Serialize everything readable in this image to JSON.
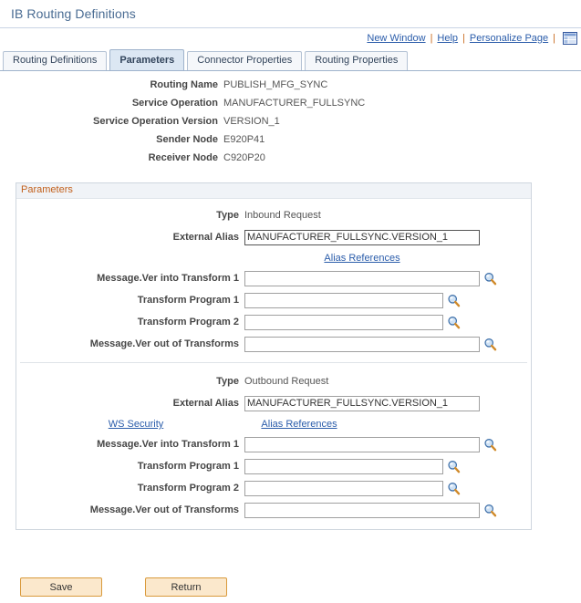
{
  "header": {
    "title": "IB Routing Definitions"
  },
  "utility_links": {
    "new_window": "New Window",
    "help": "Help",
    "personalize_page": "Personalize Page",
    "separator": "|",
    "grid_icon": "page-grid-icon"
  },
  "tabs": [
    {
      "label": "Routing Definitions",
      "active": false
    },
    {
      "label": "Parameters",
      "active": true
    },
    {
      "label": "Connector Properties",
      "active": false
    },
    {
      "label": "Routing Properties",
      "active": false
    }
  ],
  "routing_info": [
    {
      "label": "Routing Name",
      "value": "PUBLISH_MFG_SYNC"
    },
    {
      "label": "Service Operation",
      "value": "MANUFACTURER_FULLSYNC"
    },
    {
      "label": "Service Operation Version",
      "value": "VERSION_1"
    },
    {
      "label": "Sender Node",
      "value": "E920P41"
    },
    {
      "label": "Receiver Node",
      "value": "C920P20"
    }
  ],
  "parameters_group": {
    "title": "Parameters",
    "inbound": {
      "type_label": "Type",
      "type_value": "Inbound Request",
      "external_alias_label": "External Alias",
      "external_alias_value": "MANUFACTURER_FULLSYNC.VERSION_1",
      "alias_references_link": "Alias References",
      "msg_in_label": "Message.Ver into Transform 1",
      "msg_in_value": "",
      "transform1_label": "Transform Program 1",
      "transform1_value": "",
      "transform2_label": "Transform Program 2",
      "transform2_value": "",
      "msg_out_label": "Message.Ver out of Transforms",
      "msg_out_value": "",
      "lookup_icon": "magnifier-lookup-icon"
    },
    "outbound": {
      "type_label": "Type",
      "type_value": "Outbound Request",
      "external_alias_label": "External Alias",
      "external_alias_value": "MANUFACTURER_FULLSYNC.VERSION_1",
      "ws_security_link": "WS Security",
      "alias_references_link": "Alias References",
      "msg_in_label": "Message.Ver into Transform 1",
      "msg_in_value": "",
      "transform1_label": "Transform Program 1",
      "transform1_value": "",
      "transform2_label": "Transform Program 2",
      "transform2_value": "",
      "msg_out_label": "Message.Ver out of Transforms",
      "msg_out_value": "",
      "lookup_icon": "magnifier-lookup-icon"
    }
  },
  "footer_buttons": {
    "save": "Save",
    "return": "Return"
  },
  "colors": {
    "title_blue": "#4a6c93",
    "link_blue": "#2a5caa",
    "group_orange": "#c2601c",
    "button_bg": "#fbe8cc",
    "button_border": "#d99a3c",
    "tab_active_bg": "#dce7f3"
  }
}
